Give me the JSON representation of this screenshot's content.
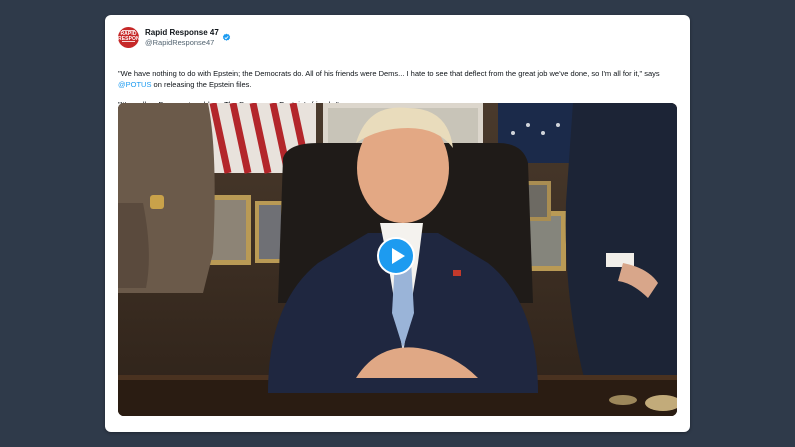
{
  "tweet": {
    "display_name": "Rapid Response 47",
    "handle": "@RapidResponse47",
    "avatar_text": "RAPID RESPONSE",
    "text_part1": "\"We have nothing to do with Epstein; the Democrats do. All of his friends were Dems... I hate to see that deflect from the great job we've done, so I'm all for it,\" says ",
    "mention": "@POTUS",
    "text_part2": " on releasing the Epstein files.",
    "quote": "\"It's really a Democrat problem. The Dems were Epstein's friends.\""
  },
  "media": {
    "type": "video",
    "play_icon": "play-icon"
  },
  "colors": {
    "background": "#2f3a4a",
    "card": "#ffffff",
    "accent": "#1d9bf0",
    "avatar": "#c62828",
    "text": "#0f1419",
    "secondary_text": "#536471"
  }
}
